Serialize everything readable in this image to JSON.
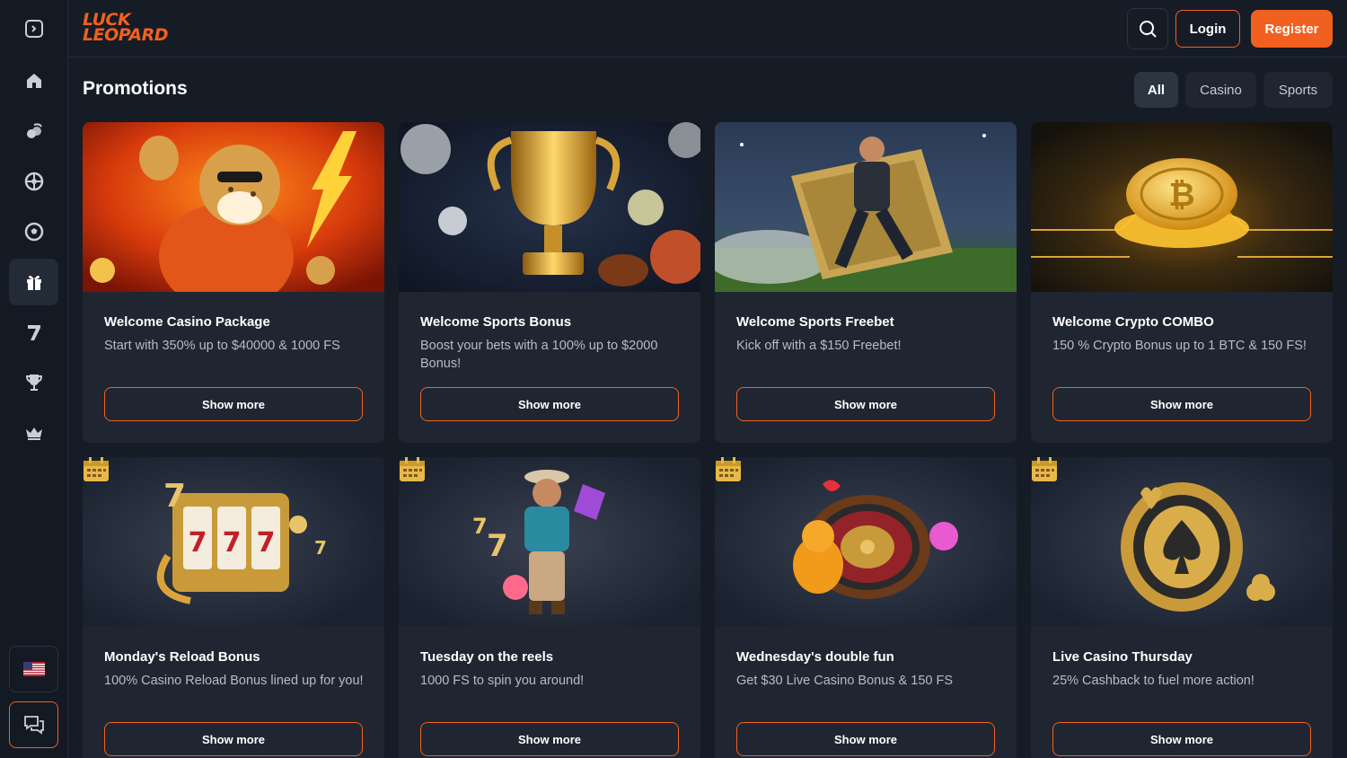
{
  "brand": {
    "line1": "LUCK",
    "line2": "LEOPARD",
    "accent": "#f2601f"
  },
  "header": {
    "login_label": "Login",
    "register_label": "Register",
    "search_icon": "search-icon"
  },
  "sidebar": {
    "items": [
      {
        "name": "collapse",
        "icon": "sidebar-toggle-icon"
      },
      {
        "name": "home",
        "icon": "home-icon"
      },
      {
        "name": "slots",
        "icon": "cherries-icon"
      },
      {
        "name": "live-casino",
        "icon": "roulette-icon"
      },
      {
        "name": "sports",
        "icon": "soccer-ball-icon"
      },
      {
        "name": "promotions",
        "icon": "gift-icon",
        "active": true
      },
      {
        "name": "lucky-7",
        "icon": "seven-icon"
      },
      {
        "name": "tournaments",
        "icon": "trophy-icon"
      },
      {
        "name": "vip",
        "icon": "crown-icon"
      }
    ],
    "language_icon": "us-flag-icon",
    "chat_icon": "chat-icon"
  },
  "main": {
    "title": "Promotions",
    "tabs": [
      {
        "label": "All",
        "active": true
      },
      {
        "label": "Casino",
        "active": false
      },
      {
        "label": "Sports",
        "active": false
      }
    ],
    "promotions": [
      {
        "title": "Welcome Casino Package",
        "desc": "Start with 350% up to $40000 & 1000 FS",
        "button": "Show more",
        "image": "leopard-art"
      },
      {
        "title": "Welcome Sports Bonus",
        "desc": "Boost your bets with a 100% up to $2000 Bonus!",
        "button": "Show more",
        "image": "trophy-art"
      },
      {
        "title": "Welcome Sports Freebet",
        "desc": "Kick off with a $150 Freebet!",
        "button": "Show more",
        "image": "soccer-player-art"
      },
      {
        "title": "Welcome Crypto COMBO",
        "desc": "150 % Crypto Bonus up to 1 BTC & 150 FS!",
        "button": "Show more",
        "image": "bitcoin-art"
      },
      {
        "title": "Monday's Reload Bonus",
        "desc": "100% Casino Reload Bonus lined up for you!",
        "button": "Show more",
        "image": "slot-machine-art"
      },
      {
        "title": "Tuesday on the reels",
        "desc": "1000 FS to spin you around!",
        "button": "Show more",
        "image": "cowboy-art"
      },
      {
        "title": "Wednesday's double fun",
        "desc": "Get $30 Live Casino Bonus & 150 FS",
        "button": "Show more",
        "image": "roulette-wheel-art"
      },
      {
        "title": "Live Casino Thursday",
        "desc": "25% Cashback to fuel more action!",
        "button": "Show more",
        "image": "poker-chip-art"
      }
    ]
  }
}
